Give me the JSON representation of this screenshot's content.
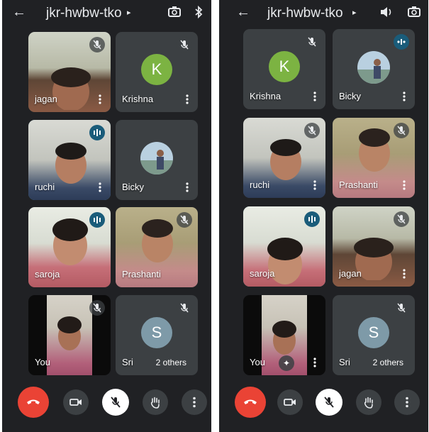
{
  "colors": {
    "background": "#202124",
    "tile": "#3c4043",
    "end_call": "#ea4335",
    "speaking_ring": "#4a8fa5",
    "avatar_k": "#7cb342",
    "avatar_s": "#7e9aa8"
  },
  "left": {
    "meeting_code": "jkr-hwbw-tko",
    "icons": [
      "back-arrow-icon",
      "caret-right-icon",
      "switch-camera-icon",
      "bluetooth-icon"
    ],
    "tiles": [
      {
        "name": "jagan",
        "status": "muted"
      },
      {
        "name": "Krishna",
        "status": "muted",
        "avatar_letter": "K"
      },
      {
        "name": "ruchi",
        "status": "speaking"
      },
      {
        "name": "Bicky",
        "status": "none"
      },
      {
        "name": "saroja",
        "status": "speaking"
      },
      {
        "name": "Prashanti",
        "status": "muted"
      },
      {
        "name": "You",
        "status": "muted"
      },
      {
        "name": "Sri",
        "status": "muted",
        "avatar_letter": "S",
        "others_label": "2 others"
      }
    ]
  },
  "right": {
    "meeting_code": "jkr-hwbw-tko",
    "icons": [
      "back-arrow-icon",
      "caret-right-icon",
      "speaker-icon",
      "switch-camera-icon"
    ],
    "tiles": [
      {
        "name": "Krishna",
        "status": "muted",
        "avatar_letter": "K"
      },
      {
        "name": "Bicky",
        "status": "speaking"
      },
      {
        "name": "ruchi",
        "status": "muted"
      },
      {
        "name": "Prashanti",
        "status": "muted"
      },
      {
        "name": "saroja",
        "status": "speaking"
      },
      {
        "name": "jagan",
        "status": "muted"
      },
      {
        "name": "You",
        "status": "none"
      },
      {
        "name": "Sri",
        "status": "muted",
        "avatar_letter": "S",
        "others_label": "2 others"
      }
    ]
  },
  "controls": [
    "end-call-button",
    "camera-button",
    "mic-muted-button",
    "raise-hand-button",
    "more-options-button"
  ]
}
